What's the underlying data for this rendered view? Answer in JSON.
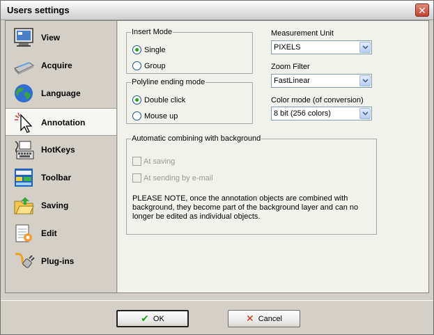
{
  "window": {
    "title": "Users settings"
  },
  "sidebar": {
    "items": [
      {
        "label": "View",
        "icon": "monitor-icon"
      },
      {
        "label": "Acquire",
        "icon": "scanner-icon"
      },
      {
        "label": "Language",
        "icon": "globe-icon"
      },
      {
        "label": "Annotation",
        "icon": "cursor-icon",
        "active": true
      },
      {
        "label": "HotKeys",
        "icon": "keyboard-icon"
      },
      {
        "label": "Toolbar",
        "icon": "toolbar-icon"
      },
      {
        "label": "Saving",
        "icon": "folder-icon"
      },
      {
        "label": "Edit",
        "icon": "notepad-icon"
      },
      {
        "label": "Plug-ins",
        "icon": "plug-icon"
      }
    ]
  },
  "annotation": {
    "insert_mode": {
      "legend": "Insert Mode",
      "options": [
        "Single",
        "Group"
      ],
      "selected": "Single"
    },
    "polyline_mode": {
      "legend": "Polyline ending mode",
      "options": [
        "Double click",
        "Mouse up"
      ],
      "selected": "Double click"
    },
    "measurement_unit": {
      "label": "Measurement Unit",
      "value": "PIXELS"
    },
    "zoom_filter": {
      "label": "Zoom Filter",
      "value": "FastLinear"
    },
    "color_mode": {
      "label": "Color mode (of conversion)",
      "value": "8 bit (256 colors)"
    },
    "combining": {
      "legend": "Automatic combining with background",
      "at_saving": "At saving",
      "at_sending": "At sending by e-mail",
      "note": "PLEASE NOTE, once the annotation objects are combined with background, they become part of the background layer and can no longer be edited as individual objects."
    }
  },
  "footer": {
    "ok_label": "OK",
    "cancel_label": "Cancel"
  },
  "colors": {
    "ok_check": "#2a9a1e",
    "cancel_x": "#d42a1a",
    "radio_dot": "#21a121"
  }
}
